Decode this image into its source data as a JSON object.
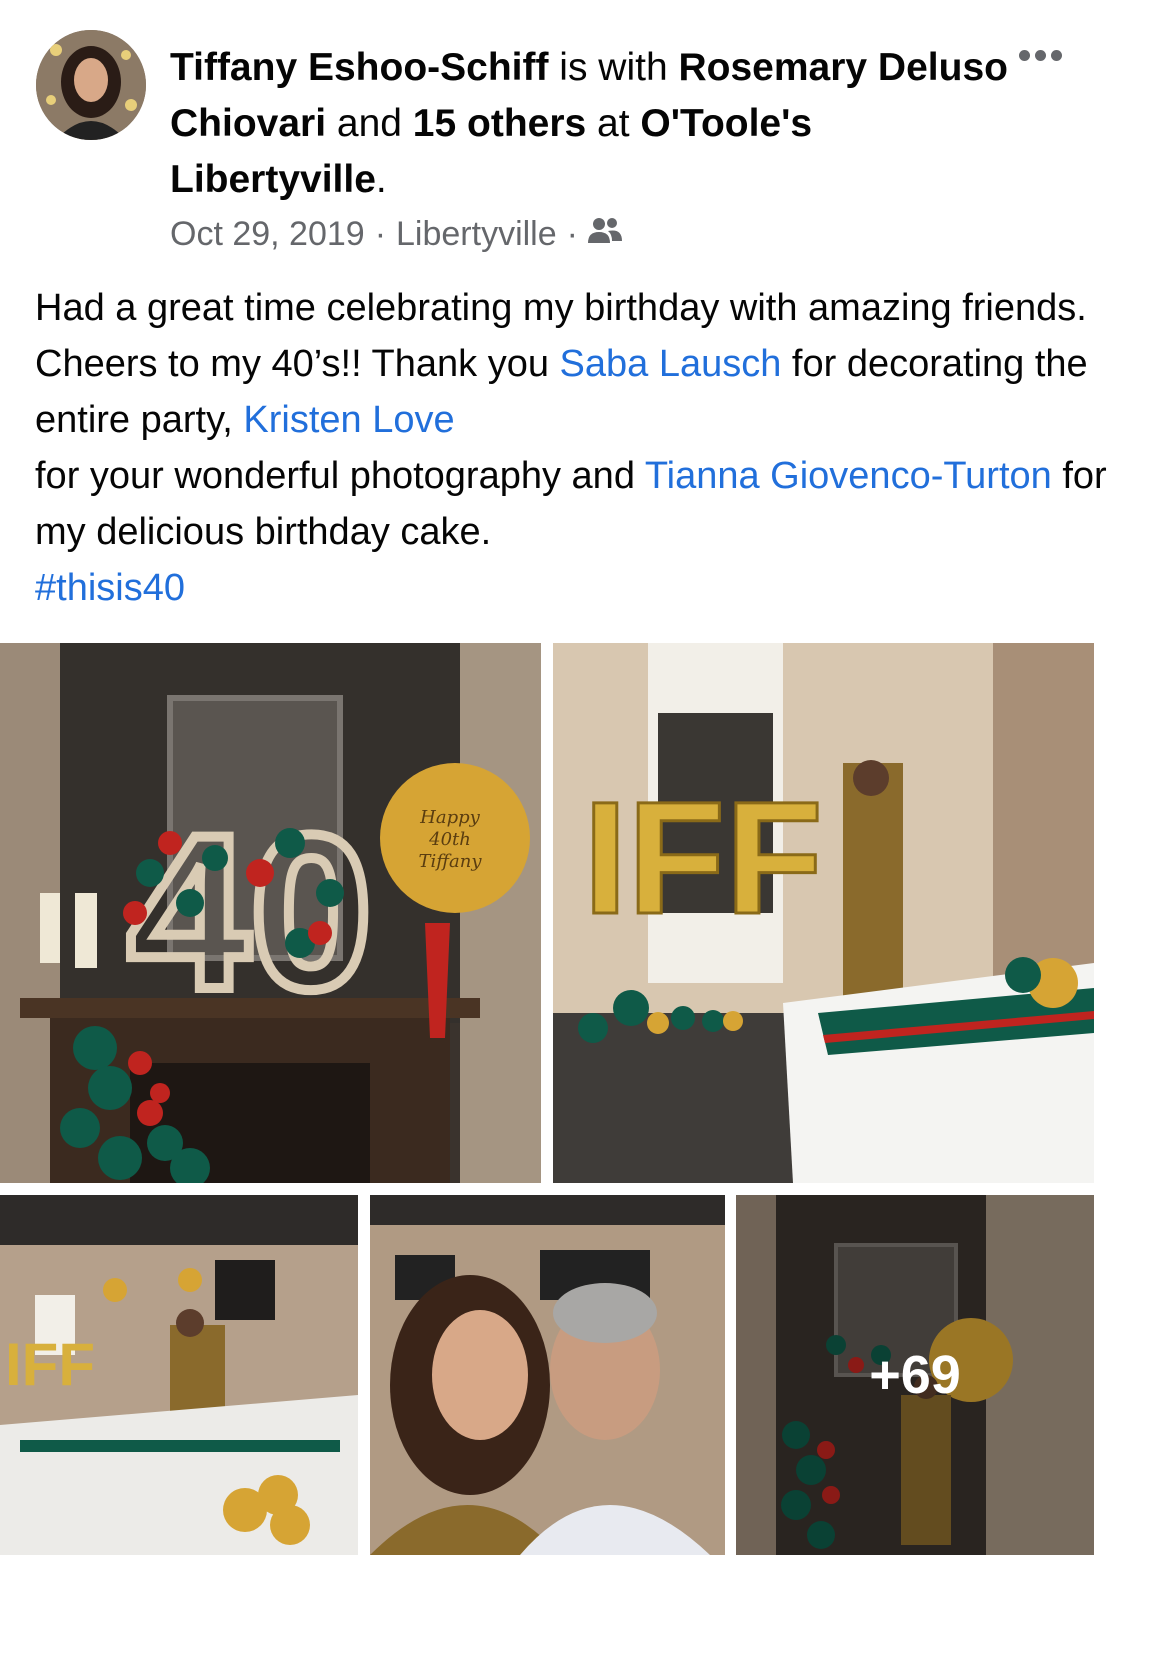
{
  "post": {
    "author": "Tiffany Eshoo-Schiff",
    "with_text": " is with ",
    "tagged_person": "Rosemary Deluso Chiovari",
    "and_text": " and ",
    "others": "15 others",
    "at_text": " at ",
    "place": "O'Toole's Libertyville",
    "period": ".",
    "date": "Oct 29, 2019",
    "dot1": "·",
    "location": "Libertyville",
    "dot2": "·",
    "audience_icon": "friends-icon",
    "more_icon": "more-options-icon"
  },
  "text": {
    "p1": "Had a great time celebrating my birthday with amazing friends. Cheers to my 40’s!! Thank you ",
    "link1": "Saba Lausch",
    "p2": " for decorating the entire party, ",
    "link2": "Kristen Love",
    "p3": " for your wonderful photography and ",
    "link3": "Tianna Giovenco-Turton",
    "p4": " for my delicious birthday cake.",
    "hashtag": "#thisis40"
  },
  "photos": {
    "balloon_text_1": "Happy",
    "balloon_text_2": "40th",
    "balloon_text_3": "Tiffany",
    "big_number": "40",
    "letters": "IFF",
    "more_count": "+69"
  },
  "colors": {
    "link": "#216fdb",
    "meta": "#65676b",
    "green_balloon": "#0f5a48",
    "red_balloon": "#c0241f",
    "gold": "#d6a434"
  }
}
